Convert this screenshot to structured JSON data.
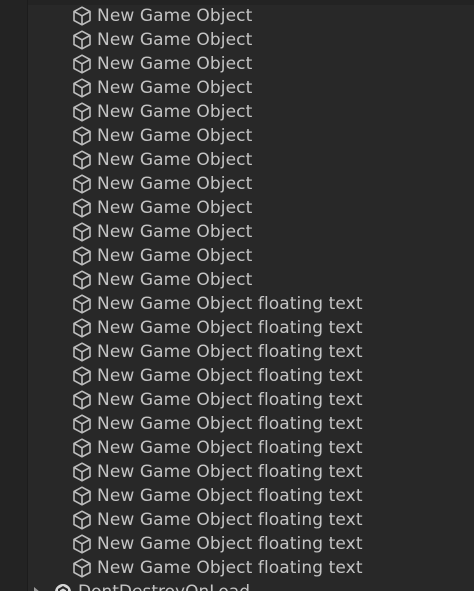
{
  "hierarchy": {
    "items": [
      {
        "label": "New Game Object",
        "icon": "cube-icon"
      },
      {
        "label": "New Game Object",
        "icon": "cube-icon"
      },
      {
        "label": "New Game Object",
        "icon": "cube-icon"
      },
      {
        "label": "New Game Object",
        "icon": "cube-icon"
      },
      {
        "label": "New Game Object",
        "icon": "cube-icon"
      },
      {
        "label": "New Game Object",
        "icon": "cube-icon"
      },
      {
        "label": "New Game Object",
        "icon": "cube-icon"
      },
      {
        "label": "New Game Object",
        "icon": "cube-icon"
      },
      {
        "label": "New Game Object",
        "icon": "cube-icon"
      },
      {
        "label": "New Game Object",
        "icon": "cube-icon"
      },
      {
        "label": "New Game Object",
        "icon": "cube-icon"
      },
      {
        "label": "New Game Object",
        "icon": "cube-icon"
      },
      {
        "label": "New Game Object floating text",
        "icon": "cube-icon"
      },
      {
        "label": "New Game Object floating text",
        "icon": "cube-icon"
      },
      {
        "label": "New Game Object floating text",
        "icon": "cube-icon"
      },
      {
        "label": "New Game Object floating text",
        "icon": "cube-icon"
      },
      {
        "label": "New Game Object floating text",
        "icon": "cube-icon"
      },
      {
        "label": "New Game Object floating text",
        "icon": "cube-icon"
      },
      {
        "label": "New Game Object floating text",
        "icon": "cube-icon"
      },
      {
        "label": "New Game Object floating text",
        "icon": "cube-icon"
      },
      {
        "label": "New Game Object floating text",
        "icon": "cube-icon"
      },
      {
        "label": "New Game Object floating text",
        "icon": "cube-icon"
      },
      {
        "label": "New Game Object floating text",
        "icon": "cube-icon"
      },
      {
        "label": "New Game Object floating text",
        "icon": "cube-icon"
      }
    ],
    "bottom_row": {
      "label": "DontDestroyOnLoad",
      "icon": "unity-scene-icon",
      "expand_icon": "foldout-arrow-icon"
    }
  },
  "colors": {
    "background": "#282828",
    "gutter": "#232323",
    "text": "#c4c4c4",
    "icon": "#bdbdbd"
  }
}
